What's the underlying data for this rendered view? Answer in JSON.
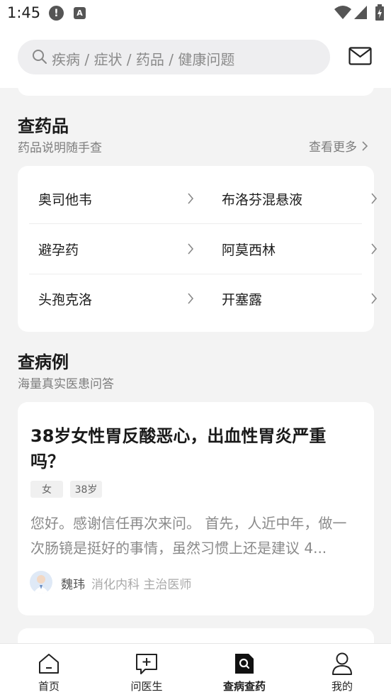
{
  "status": {
    "time": "1:45",
    "alert_glyph": "!",
    "a_glyph": "A",
    "icons": [
      "alert-icon",
      "a-icon",
      "wifi-icon",
      "signal-icon",
      "battery-icon"
    ]
  },
  "search": {
    "placeholder": "疾病 / 症状 / 药品 / 健康问题"
  },
  "drugs": {
    "title": "查药品",
    "subtitle": "药品说明随手查",
    "more": "查看更多",
    "items": [
      {
        "label": "奥司他韦"
      },
      {
        "label": "布洛芬混悬液"
      },
      {
        "label": "避孕药"
      },
      {
        "label": "阿莫西林"
      },
      {
        "label": "头孢克洛"
      },
      {
        "label": "开塞露"
      }
    ]
  },
  "cases": {
    "title": "查病例",
    "subtitle": "海量真实医患问答",
    "items": [
      {
        "title": "38岁女性胃反酸恶心，出血性胃炎严重吗？",
        "tags": [
          "女",
          "38岁"
        ],
        "body": "您好。感谢信任再次来问。 首先，人近中年，做一次肠镜是挺好的事情，虽然习惯上还是建议 4...",
        "doctor": {
          "name": "魏玮",
          "dept": "消化内科 主治医师"
        }
      }
    ]
  },
  "nav": {
    "items": [
      {
        "label": "首页",
        "icon": "home-icon"
      },
      {
        "label": "问医生",
        "icon": "ask-doctor-icon"
      },
      {
        "label": "查病查药",
        "icon": "search-disease-icon",
        "active": true
      },
      {
        "label": "我的",
        "icon": "profile-icon"
      }
    ]
  }
}
